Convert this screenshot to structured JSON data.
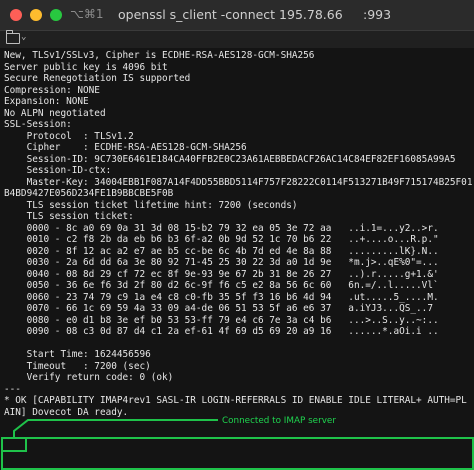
{
  "window": {
    "shortcut": "⌥⌘1",
    "title": "openssl s_client -connect 195.78.66",
    "port": ":993"
  },
  "tab": {
    "icon": "folder-icon"
  },
  "terminal": {
    "lines": [
      "New, TLSv1/SSLv3, Cipher is ECDHE-RSA-AES128-GCM-SHA256",
      "Server public key is 4096 bit",
      "Secure Renegotiation IS supported",
      "Compression: NONE",
      "Expansion: NONE",
      "No ALPN negotiated",
      "SSL-Session:",
      "    Protocol  : TLSv1.2",
      "    Cipher    : ECDHE-RSA-AES128-GCM-SHA256",
      "    Session-ID: 9C730E6461E184CA40FFB2E0C23A61AEBBEDACF26AC14C84EF82EF16085A99A5",
      "    Session-ID-ctx:",
      "    Master-Key: 34004EBB1F087A14F4DD55BBD5114F757F28222C0114F513271B49F715174B25F01",
      "B4BD9427E056D234FE1B9BBCBE5F0B",
      "    TLS session ticket lifetime hint: 7200 (seconds)",
      "    TLS session ticket:",
      "    0000 - 8c a0 69 0a 31 3d 08 15-b2 79 32 ea 05 3e 72 aa   ..i.1=...y2..>r.",
      "    0010 - c2 f8 2b da eb b6 b3 6f-a2 0b 9d 52 1c 70 b6 22   ..+....o...R.p.\"",
      "    0020 - 8f 12 ac a2 e7 ae b5 cc-be 6c 4b 7d ed 4e 8a 88   .........lK}.N..",
      "    0030 - 2a 6d dd 6a 3e 80 92 71-45 25 30 22 3d a0 1d 9e   *m.j>..qE%0\"=...",
      "    0040 - 08 8d 29 cf 72 ec 8f 9e-93 9e 67 2b 31 8e 26 27   ..).r.....g+1.&'",
      "    0050 - 36 6e f6 3d 2f 80 d2 6c-9f f6 c5 e2 8a 56 6c 60   6n.=/..l.....Vl`",
      "    0060 - 23 74 79 c9 1a e4 c8 c0-fb 35 5f f3 16 b6 4d 94   .ut.....5_....M.",
      "    0070 - 66 1c 69 59 4a 33 09 a4-de 06 51 53 5f a6 e6 37   a.iYJ3...QS_..7",
      "    0080 - e0 d1 b8 3e ef b0 53 53-ff 79 e4 c6 7e 3a c4 b6   ...>..S..y..~:..",
      "    0090 - 08 c3 0d 87 d4 c1 2a ef-61 4f 69 d5 69 20 a9 16   ......*.aOi.i ..",
      "",
      "    Start Time: 1624456596",
      "    Timeout   : 7200 (sec)",
      "    Verify return code: 0 (ok)",
      "---",
      "* OK [CAPABILITY IMAP4rev1 SASL-IR LOGIN-REFERRALS ID ENABLE IDLE LITERAL+ AUTH=PL",
      "AIN] Dovecot DA ready."
    ]
  },
  "annotation": {
    "label": "Connected to IMAP server",
    "color": "#1fc24a"
  }
}
